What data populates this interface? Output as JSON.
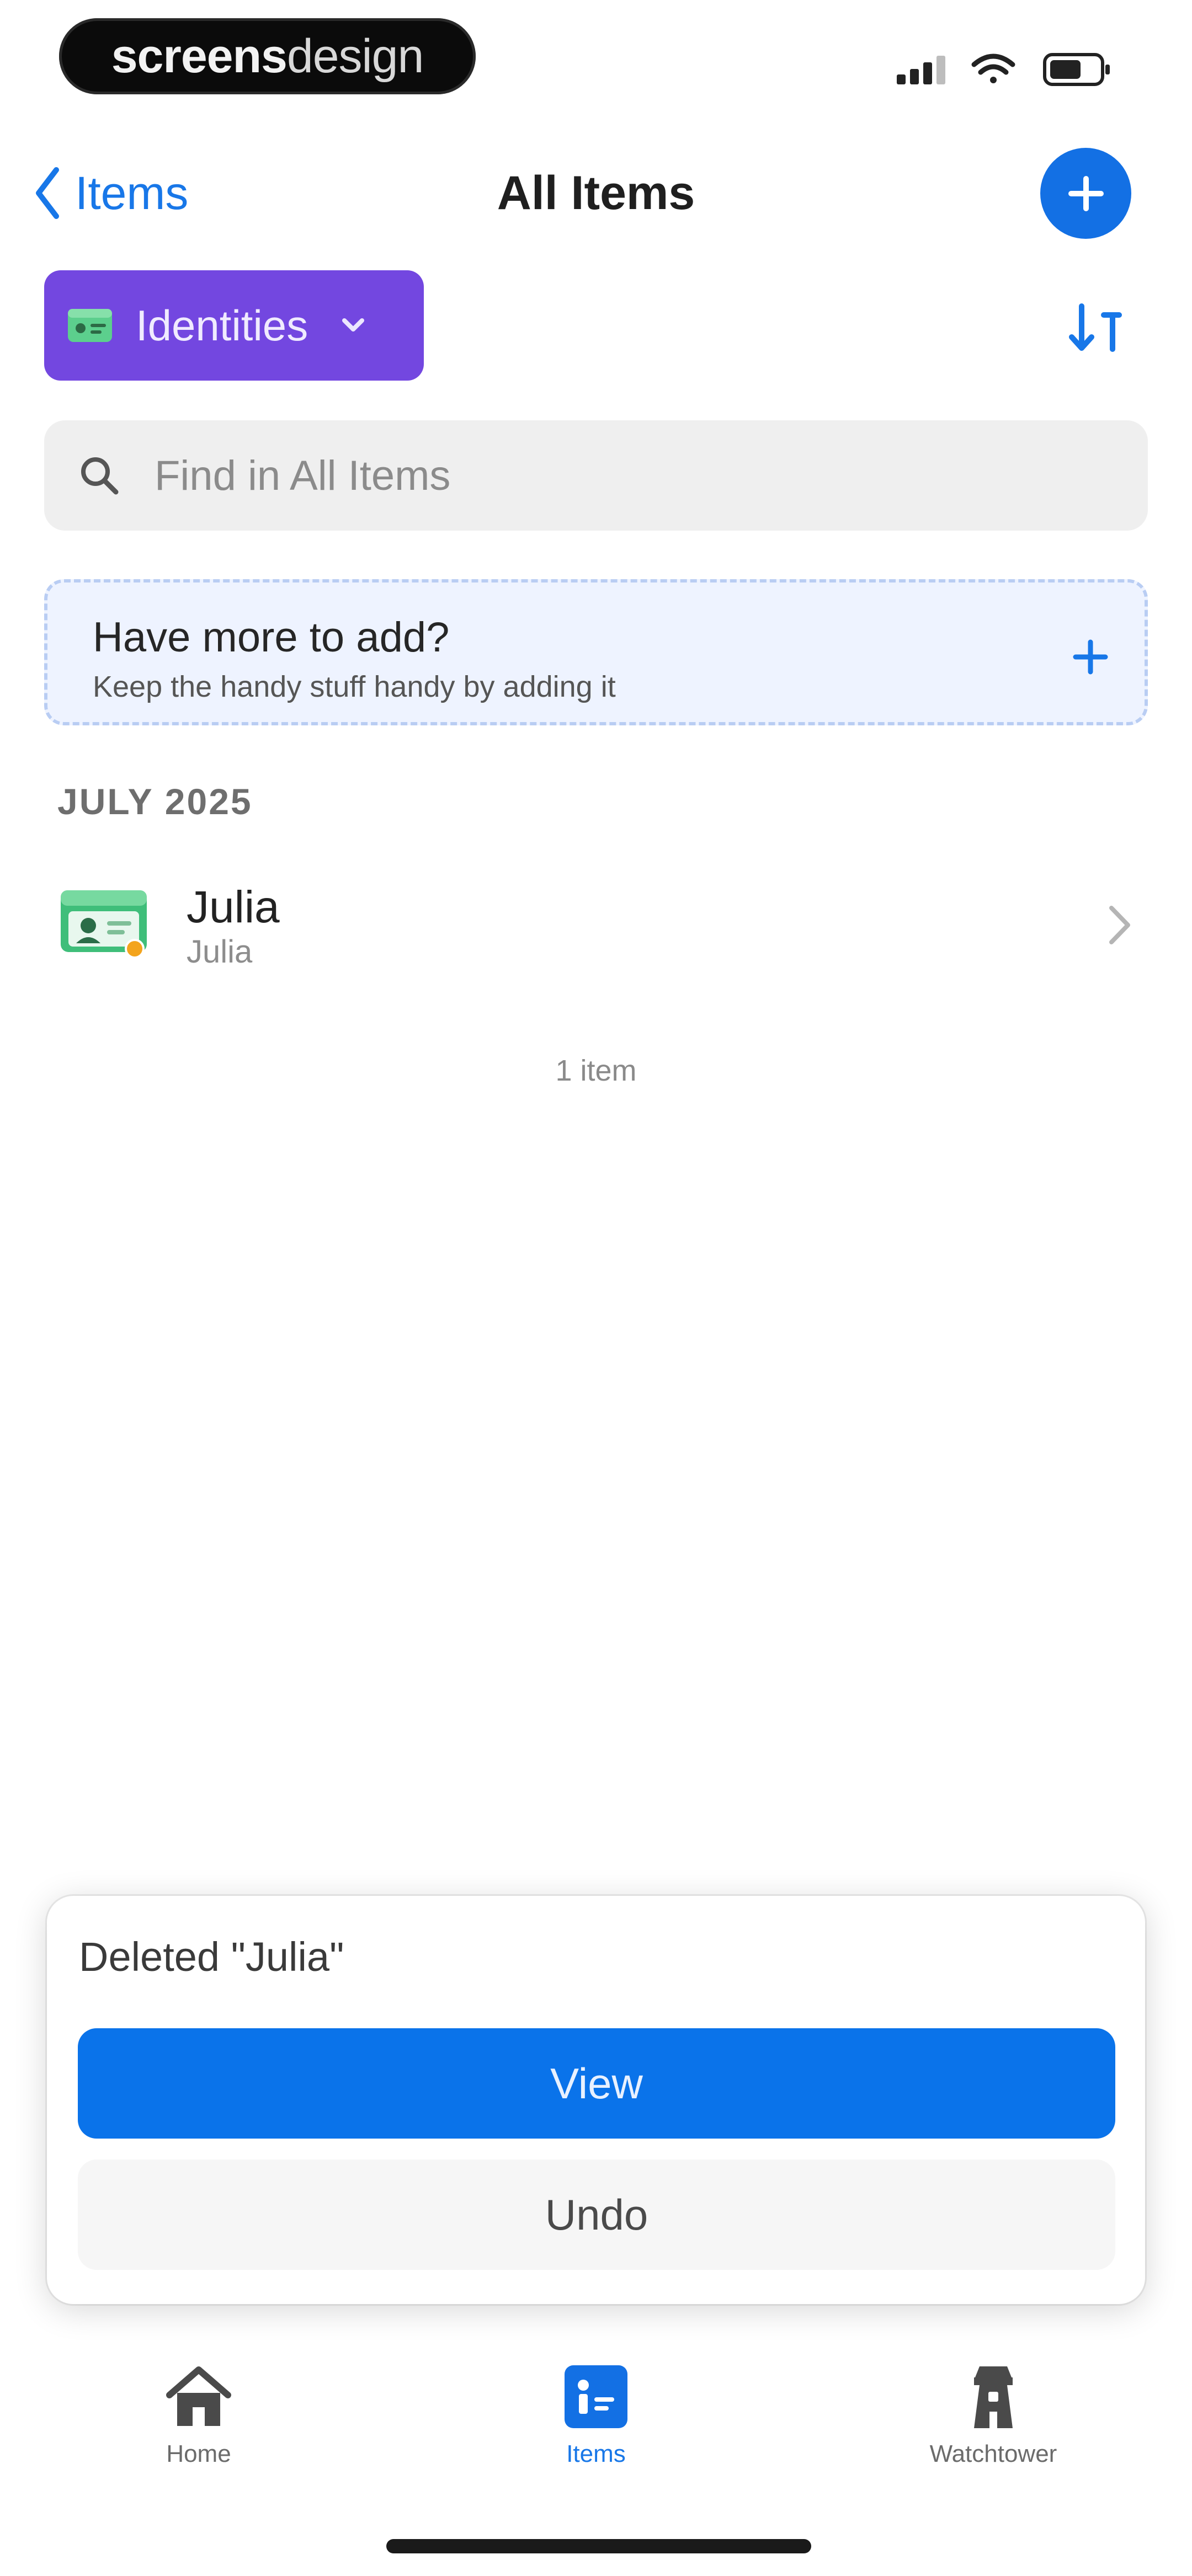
{
  "status_bar": {
    "brand_part1": "screens",
    "brand_part2": "design",
    "icons": [
      "signal-icon",
      "wifi-icon",
      "battery-icon"
    ]
  },
  "nav": {
    "back_label": "Items",
    "title": "All Items",
    "add_icon": "plus-icon"
  },
  "filter": {
    "category_label": "Identities",
    "sort_icon": "sort-icon"
  },
  "search": {
    "placeholder": "Find in All Items"
  },
  "promo": {
    "title": "Have more to add?",
    "subtitle": "Keep the handy stuff handy by adding it"
  },
  "list": {
    "section_header": "JULY 2025",
    "items": [
      {
        "title": "Julia",
        "subtitle": "Julia"
      }
    ],
    "count_text": "1 item"
  },
  "toast": {
    "message": "Deleted \"Julia\"",
    "view_label": "View",
    "undo_label": "Undo"
  },
  "tabbar": {
    "tabs": [
      {
        "label": "Home",
        "icon": "house-icon",
        "active": false
      },
      {
        "label": "Items",
        "icon": "items-icon",
        "active": true
      },
      {
        "label": "Watchtower",
        "icon": "tower-icon",
        "active": false
      }
    ]
  },
  "colors": {
    "accent": "#1370e4",
    "category": "#7347e0",
    "identity_icon": "#3fbe7a"
  }
}
